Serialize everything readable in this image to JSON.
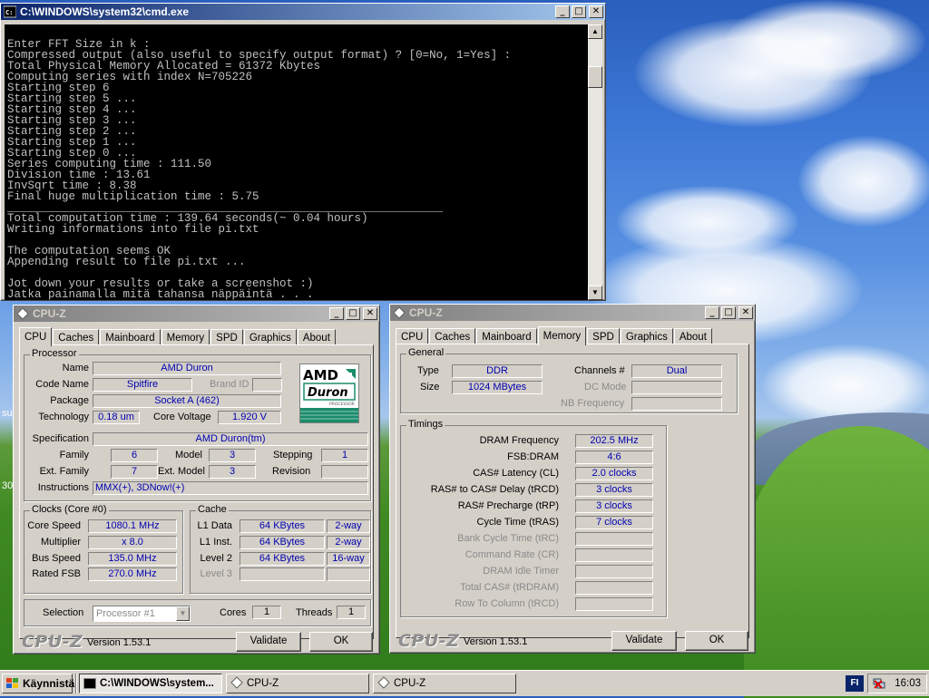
{
  "console": {
    "title": "C:\\WINDOWS\\system32\\cmd.exe",
    "lines": [
      "Enter FFT Size in k :",
      "Compressed output (also useful to specify output format) ? [0=No, 1=Yes] :",
      "Total Physical Memory Allocated = 61372 Kbytes",
      "Computing series with index N=705226",
      "Starting step 6",
      "Starting step 5 ...",
      "Starting step 4 ...",
      "Starting step 3 ...",
      "Starting step 2 ...",
      "Starting step 1 ...",
      "Starting step 0 ...",
      "Series computing time : 111.50",
      "Division time : 13.61",
      "InvSqrt time : 8.38",
      "Final huge multiplication time : 5.75",
      "________________________________________________________________",
      "Total computation time : 139.64 seconds(~ 0.04 hours)",
      "Writing informations into file pi.txt",
      "",
      "The computation seems OK",
      "Appending result to file pi.txt ...",
      "",
      "Jot down your results or take a screenshot :)",
      "Jatka painamalla mitä tahansa näppäintä . . ."
    ]
  },
  "cpuz_left": {
    "title": "CPU-Z",
    "tabs": [
      "CPU",
      "Caches",
      "Mainboard",
      "Memory",
      "SPD",
      "Graphics",
      "About"
    ],
    "processor": {
      "group": "Processor",
      "name_label": "Name",
      "name": "AMD Duron",
      "codename_label": "Code Name",
      "codename": "Spitfire",
      "brandid_label": "Brand ID",
      "brandid": "",
      "package_label": "Package",
      "package": "Socket A (462)",
      "tech_label": "Technology",
      "tech": "0.18 um",
      "voltage_label": "Core Voltage",
      "voltage": "1.920 V",
      "spec_label": "Specification",
      "spec": "AMD Duron(tm)",
      "family_label": "Family",
      "family": "6",
      "model_label": "Model",
      "model": "3",
      "stepping_label": "Stepping",
      "stepping": "1",
      "extfamily_label": "Ext. Family",
      "extfamily": "7",
      "extmodel_label": "Ext. Model",
      "extmodel": "3",
      "revision_label": "Revision",
      "revision": "",
      "instr_label": "Instructions",
      "instr": "MMX(+), 3DNow!(+)",
      "logo_top": "AMD",
      "logo_bottom": "Duron",
      "logo_tag": "PROCESSOR"
    },
    "clocks": {
      "group": "Clocks (Core #0)",
      "corespeed_label": "Core Speed",
      "corespeed": "1080.1 MHz",
      "mult_label": "Multiplier",
      "mult": "x 8.0",
      "bus_label": "Bus Speed",
      "bus": "135.0 MHz",
      "fsb_label": "Rated FSB",
      "fsb": "270.0 MHz"
    },
    "cache": {
      "group": "Cache",
      "l1d_label": "L1 Data",
      "l1d": "64 KBytes",
      "l1d_way": "2-way",
      "l1i_label": "L1 Inst.",
      "l1i": "64 KBytes",
      "l1i_way": "2-way",
      "l2_label": "Level 2",
      "l2": "64 KBytes",
      "l2_way": "16-way",
      "l3_label": "Level 3",
      "l3": "",
      "l3_way": ""
    },
    "selection_label": "Selection",
    "selection": "Processor #1",
    "cores_label": "Cores",
    "cores": "1",
    "threads_label": "Threads",
    "threads": "1",
    "brand": "CPU-Z",
    "version": "Version 1.53.1",
    "validate": "Validate",
    "ok": "OK"
  },
  "cpuz_right": {
    "title": "CPU-Z",
    "tabs": [
      "CPU",
      "Caches",
      "Mainboard",
      "Memory",
      "SPD",
      "Graphics",
      "About"
    ],
    "general": {
      "group": "General",
      "type_label": "Type",
      "type": "DDR",
      "channels_label": "Channels #",
      "channels": "Dual",
      "size_label": "Size",
      "size": "1024 MBytes",
      "dcmode_label": "DC Mode",
      "dcmode": "",
      "nbfreq_label": "NB Frequency",
      "nbfreq": ""
    },
    "timings": {
      "group": "Timings",
      "rows": [
        {
          "label": "DRAM Frequency",
          "value": "202.5 MHz",
          "enabled": true
        },
        {
          "label": "FSB:DRAM",
          "value": "4:6",
          "enabled": true
        },
        {
          "label": "CAS# Latency (CL)",
          "value": "2.0 clocks",
          "enabled": true
        },
        {
          "label": "RAS# to CAS# Delay (tRCD)",
          "value": "3 clocks",
          "enabled": true
        },
        {
          "label": "RAS# Precharge (tRP)",
          "value": "3 clocks",
          "enabled": true
        },
        {
          "label": "Cycle Time (tRAS)",
          "value": "7 clocks",
          "enabled": true
        },
        {
          "label": "Bank Cycle Time (tRC)",
          "value": "",
          "enabled": false
        },
        {
          "label": "Command Rate (CR)",
          "value": "",
          "enabled": false
        },
        {
          "label": "DRAM Idle Timer",
          "value": "",
          "enabled": false
        },
        {
          "label": "Total CAS# (tRDRAM)",
          "value": "",
          "enabled": false
        },
        {
          "label": "Row To Column (tRCD)",
          "value": "",
          "enabled": false
        }
      ]
    },
    "brand": "CPU-Z",
    "version": "Version 1.53.1",
    "validate": "Validate",
    "ok": "OK"
  },
  "taskbar": {
    "start": "Käynnistä",
    "tasks": [
      "C:\\WINDOWS\\system...",
      "CPU-Z",
      "CPU-Z"
    ],
    "lang": "FI",
    "clock": "16:03"
  },
  "desktop": {
    "edge_texts": [
      "su",
      "30"
    ]
  }
}
